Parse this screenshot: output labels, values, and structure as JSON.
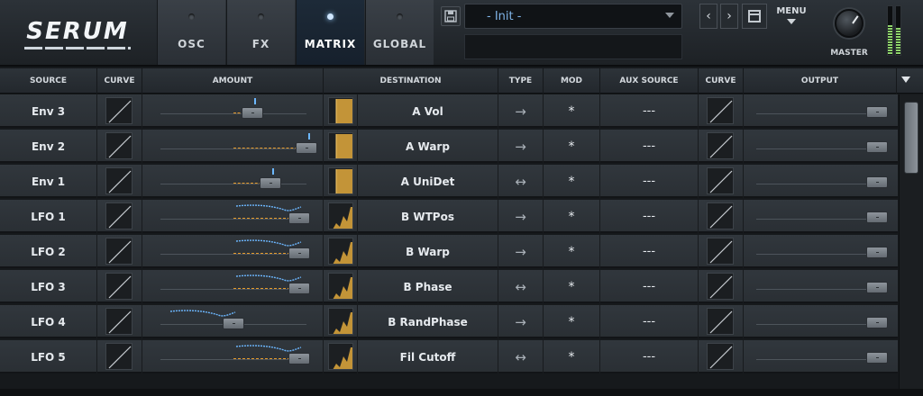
{
  "app": {
    "logo": "SERUM"
  },
  "tabs": [
    {
      "label": "OSC",
      "active": false
    },
    {
      "label": "FX",
      "active": false
    },
    {
      "label": "MATRIX",
      "active": true
    },
    {
      "label": "GLOBAL",
      "active": false
    }
  ],
  "preset": {
    "name": "- Init -",
    "save_icon": "floppy-disk-icon",
    "prev_label": "‹",
    "next_label": "›",
    "menu_label": "MENU"
  },
  "master": {
    "label": "MASTER",
    "meter_left_level": 0.62,
    "meter_right_level": 0.55
  },
  "columns": {
    "source": "SOURCE",
    "curve": "CURVE",
    "amount": "AMOUNT",
    "destination": "DESTINATION",
    "type": "TYPE",
    "mod": "MOD",
    "aux_source": "AUX SOURCE",
    "curve2": "CURVE",
    "output": "OUTPUT"
  },
  "rows": [
    {
      "source": "Env 3",
      "destination": "A Vol",
      "type": "→",
      "mod": "*",
      "aux": "---",
      "amount": 0.63,
      "kind": "env"
    },
    {
      "source": "Env 2",
      "destination": "A Warp",
      "type": "→",
      "mod": "*",
      "aux": "---",
      "amount": 1.0,
      "kind": "env"
    },
    {
      "source": "Env 1",
      "destination": "A UniDet",
      "type": "↔",
      "mod": "*",
      "aux": "---",
      "amount": 0.75,
      "kind": "env"
    },
    {
      "source": "LFO 1",
      "destination": "B WTPos",
      "type": "→",
      "mod": "*",
      "aux": "---",
      "amount": 0.95,
      "kind": "lfo"
    },
    {
      "source": "LFO 2",
      "destination": "B Warp",
      "type": "→",
      "mod": "*",
      "aux": "---",
      "amount": 0.95,
      "kind": "lfo"
    },
    {
      "source": "LFO 3",
      "destination": "B Phase",
      "type": "↔",
      "mod": "*",
      "aux": "---",
      "amount": 0.95,
      "kind": "lfo"
    },
    {
      "source": "LFO 4",
      "destination": "B RandPhase",
      "type": "→",
      "mod": "*",
      "aux": "---",
      "amount": 0.5,
      "kind": "lfo"
    },
    {
      "source": "LFO 5",
      "destination": "Fil Cutoff",
      "type": "↔",
      "mod": "*",
      "aux": "---",
      "amount": 0.95,
      "kind": "lfo"
    }
  ],
  "colors": {
    "accent_orange": "#e59b2c",
    "accent_blue": "#6cb7ff",
    "meter_green": "#8fd46c"
  }
}
